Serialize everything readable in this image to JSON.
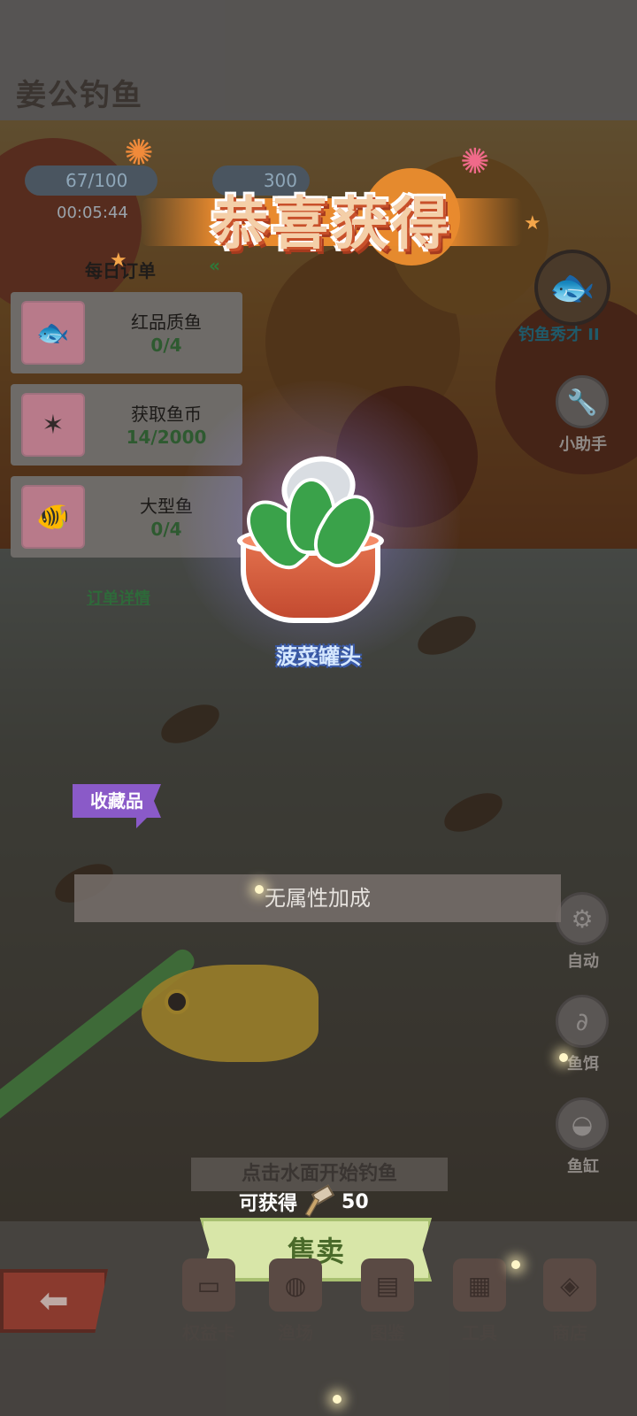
{
  "header": {
    "app_title": "姜公钓鱼"
  },
  "status": {
    "energy": "67/100",
    "timer": "00:05:44",
    "coins": "300"
  },
  "orders": {
    "title": "每日订单",
    "collapse_icon": "double-chevron-left",
    "items": [
      {
        "name": "红品质鱼",
        "progress": "0/4",
        "icon": "fish-icon"
      },
      {
        "name": "获取鱼币",
        "progress": "14/2000",
        "icon": "starfish-icon"
      },
      {
        "name": "大型鱼",
        "progress": "0/4",
        "icon": "fish-icon"
      }
    ],
    "detail_link": "订单详情"
  },
  "right_panel": {
    "title_label": "钓鱼秀才 II",
    "helper_label": "小助手",
    "auto_label": "自动",
    "bait_label": "鱼饵",
    "tank_label": "鱼缸"
  },
  "popup": {
    "congrats": "恭喜获得",
    "item_name": "菠菜罐头",
    "tag": "收藏品",
    "attribute": "无属性加成",
    "hint": "点击水面开始钓鱼",
    "earn_label": "可获得",
    "earn_value": "50",
    "sell_label": "售卖"
  },
  "bottom_nav": {
    "items": [
      {
        "label": "权益卡",
        "icon": "card-icon"
      },
      {
        "label": "渔场",
        "icon": "pond-icon"
      },
      {
        "label": "图鉴",
        "icon": "book-icon"
      },
      {
        "label": "工具",
        "icon": "box-icon"
      },
      {
        "label": "商店",
        "icon": "shop-icon"
      }
    ]
  },
  "colors": {
    "accent_orange": "#e98a2e",
    "tag_purple": "#8a5ac8",
    "sell_green": "#d8e6a8",
    "item_name_blue": "#3a5aa8"
  }
}
